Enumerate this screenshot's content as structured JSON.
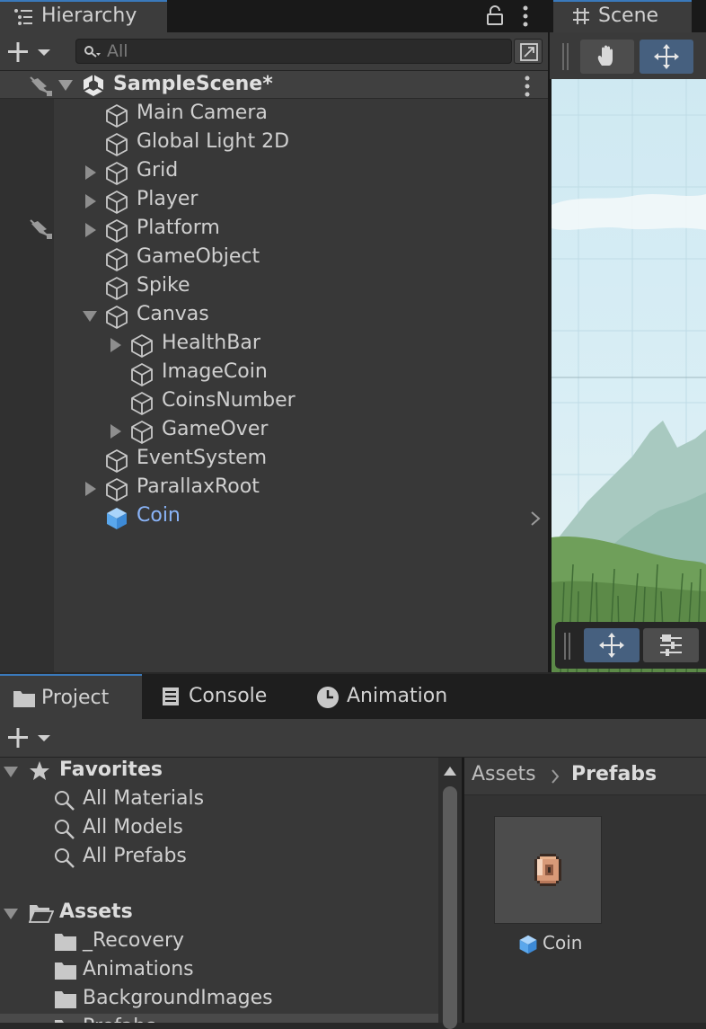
{
  "hierarchy": {
    "tab_label": "Hierarchy",
    "search_placeholder": "All",
    "scene_name": "SampleScene*",
    "items": [
      {
        "name": "Main Camera"
      },
      {
        "name": "Global Light 2D"
      },
      {
        "name": "Grid"
      },
      {
        "name": "Player"
      },
      {
        "name": "Platform"
      },
      {
        "name": "GameObject"
      },
      {
        "name": "Spike"
      },
      {
        "name": "Canvas"
      },
      {
        "name": "HealthBar"
      },
      {
        "name": "ImageCoin"
      },
      {
        "name": "CoinsNumber"
      },
      {
        "name": "GameOver"
      },
      {
        "name": "EventSystem"
      },
      {
        "name": "ParallaxRoot"
      },
      {
        "name": "Coin"
      }
    ]
  },
  "scene": {
    "tab_label": "Scene"
  },
  "bottom_tabs": [
    {
      "label": "Project"
    },
    {
      "label": "Console"
    },
    {
      "label": "Animation"
    }
  ],
  "project": {
    "favorites_label": "Favorites",
    "favorites": [
      "All Materials",
      "All Models",
      "All Prefabs"
    ],
    "assets_label": "Assets",
    "folders": [
      "_Recovery",
      "Animations",
      "BackgroundImages",
      "Prefabs"
    ],
    "breadcrumb": [
      "Assets",
      "Prefabs"
    ],
    "grid_items": [
      {
        "label": "Coin"
      }
    ]
  },
  "colors": {
    "accent_blue": "#3a79bb",
    "prefab_blue": "#7bb7f0",
    "selected_text": "#8ab4f8"
  }
}
